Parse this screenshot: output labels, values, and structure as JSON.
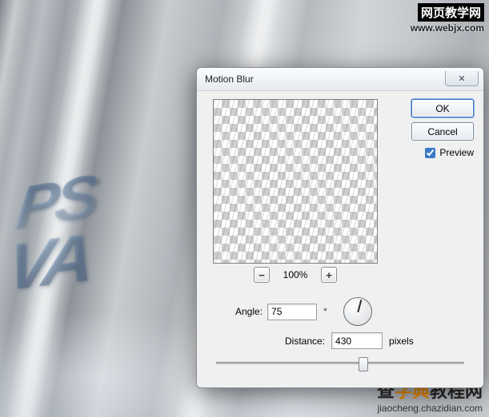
{
  "watermark_top": {
    "line1": "网页教学网",
    "line2": "www.webjx.com"
  },
  "watermark_bottom": {
    "brand_pre": "查",
    "brand_hi": "字典",
    "brand_post": "教程网",
    "url": "jiaocheng.chazidian.com"
  },
  "bg_text": {
    "line1": "PS",
    "line2": "VA"
  },
  "dialog": {
    "title": "Motion Blur",
    "close_glyph": "✕",
    "ok_label": "OK",
    "cancel_label": "Cancel",
    "preview_label": "Preview",
    "preview_checked": true,
    "zoom": {
      "minus": "−",
      "plus": "+",
      "percent": "100%"
    },
    "angle": {
      "label": "Angle:",
      "value": "75",
      "degree": "°"
    },
    "distance": {
      "label": "Distance:",
      "value": "430",
      "unit": "pixels"
    }
  }
}
